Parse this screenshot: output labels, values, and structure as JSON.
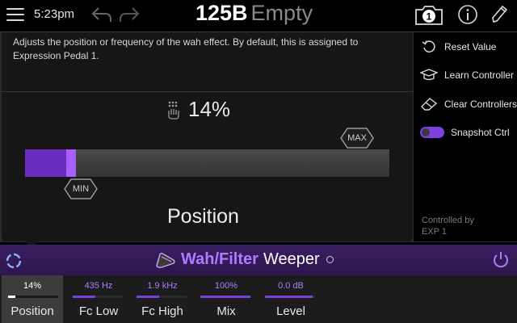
{
  "header": {
    "time": "5:23pm",
    "preset_id": "125B",
    "preset_name": "Empty",
    "snapshot_number": "1",
    "icons": [
      "menu-icon",
      "undo-icon",
      "redo-icon",
      "snapshot-icon",
      "info-icon",
      "pencil-icon"
    ]
  },
  "editor": {
    "description": "Adjusts the position or frequency of the wah effect. By default, this is assigned to Expression Pedal 1.",
    "value": "14%",
    "value_fraction": 0.14,
    "min_label": "MIN",
    "max_label": "MAX",
    "param_name": "Position"
  },
  "menu": {
    "items": [
      {
        "label": "Reset Value",
        "icon": "reset-icon"
      },
      {
        "label": "Learn Controller",
        "icon": "learn-controller-icon"
      },
      {
        "label": "Clear Controllers",
        "icon": "eraser-icon"
      },
      {
        "label": "Snapshot Ctrl",
        "icon": "toggle-switch"
      }
    ],
    "controlled_by_line1": "Controlled by",
    "controlled_by_line2": "EXP 1"
  },
  "model": {
    "category": "Wah/Filter",
    "name": "Weeper"
  },
  "params": [
    {
      "value": "14%",
      "name": "Position",
      "fill": 0.14,
      "selected": true
    },
    {
      "value": "435 Hz",
      "name": "Fc Low",
      "fill": 0.45,
      "selected": false
    },
    {
      "value": "1.9 kHz",
      "name": "Fc High",
      "fill": 0.45,
      "selected": false
    },
    {
      "value": "100%",
      "name": "Mix",
      "fill": 1.0,
      "selected": false
    },
    {
      "value": "0.0 dB",
      "name": "Level",
      "fill": 0.95,
      "selected": false
    }
  ],
  "colors": {
    "accent": "#7d3fe0",
    "accent_light": "#b07cff",
    "model_bar": "#3a1e63"
  }
}
